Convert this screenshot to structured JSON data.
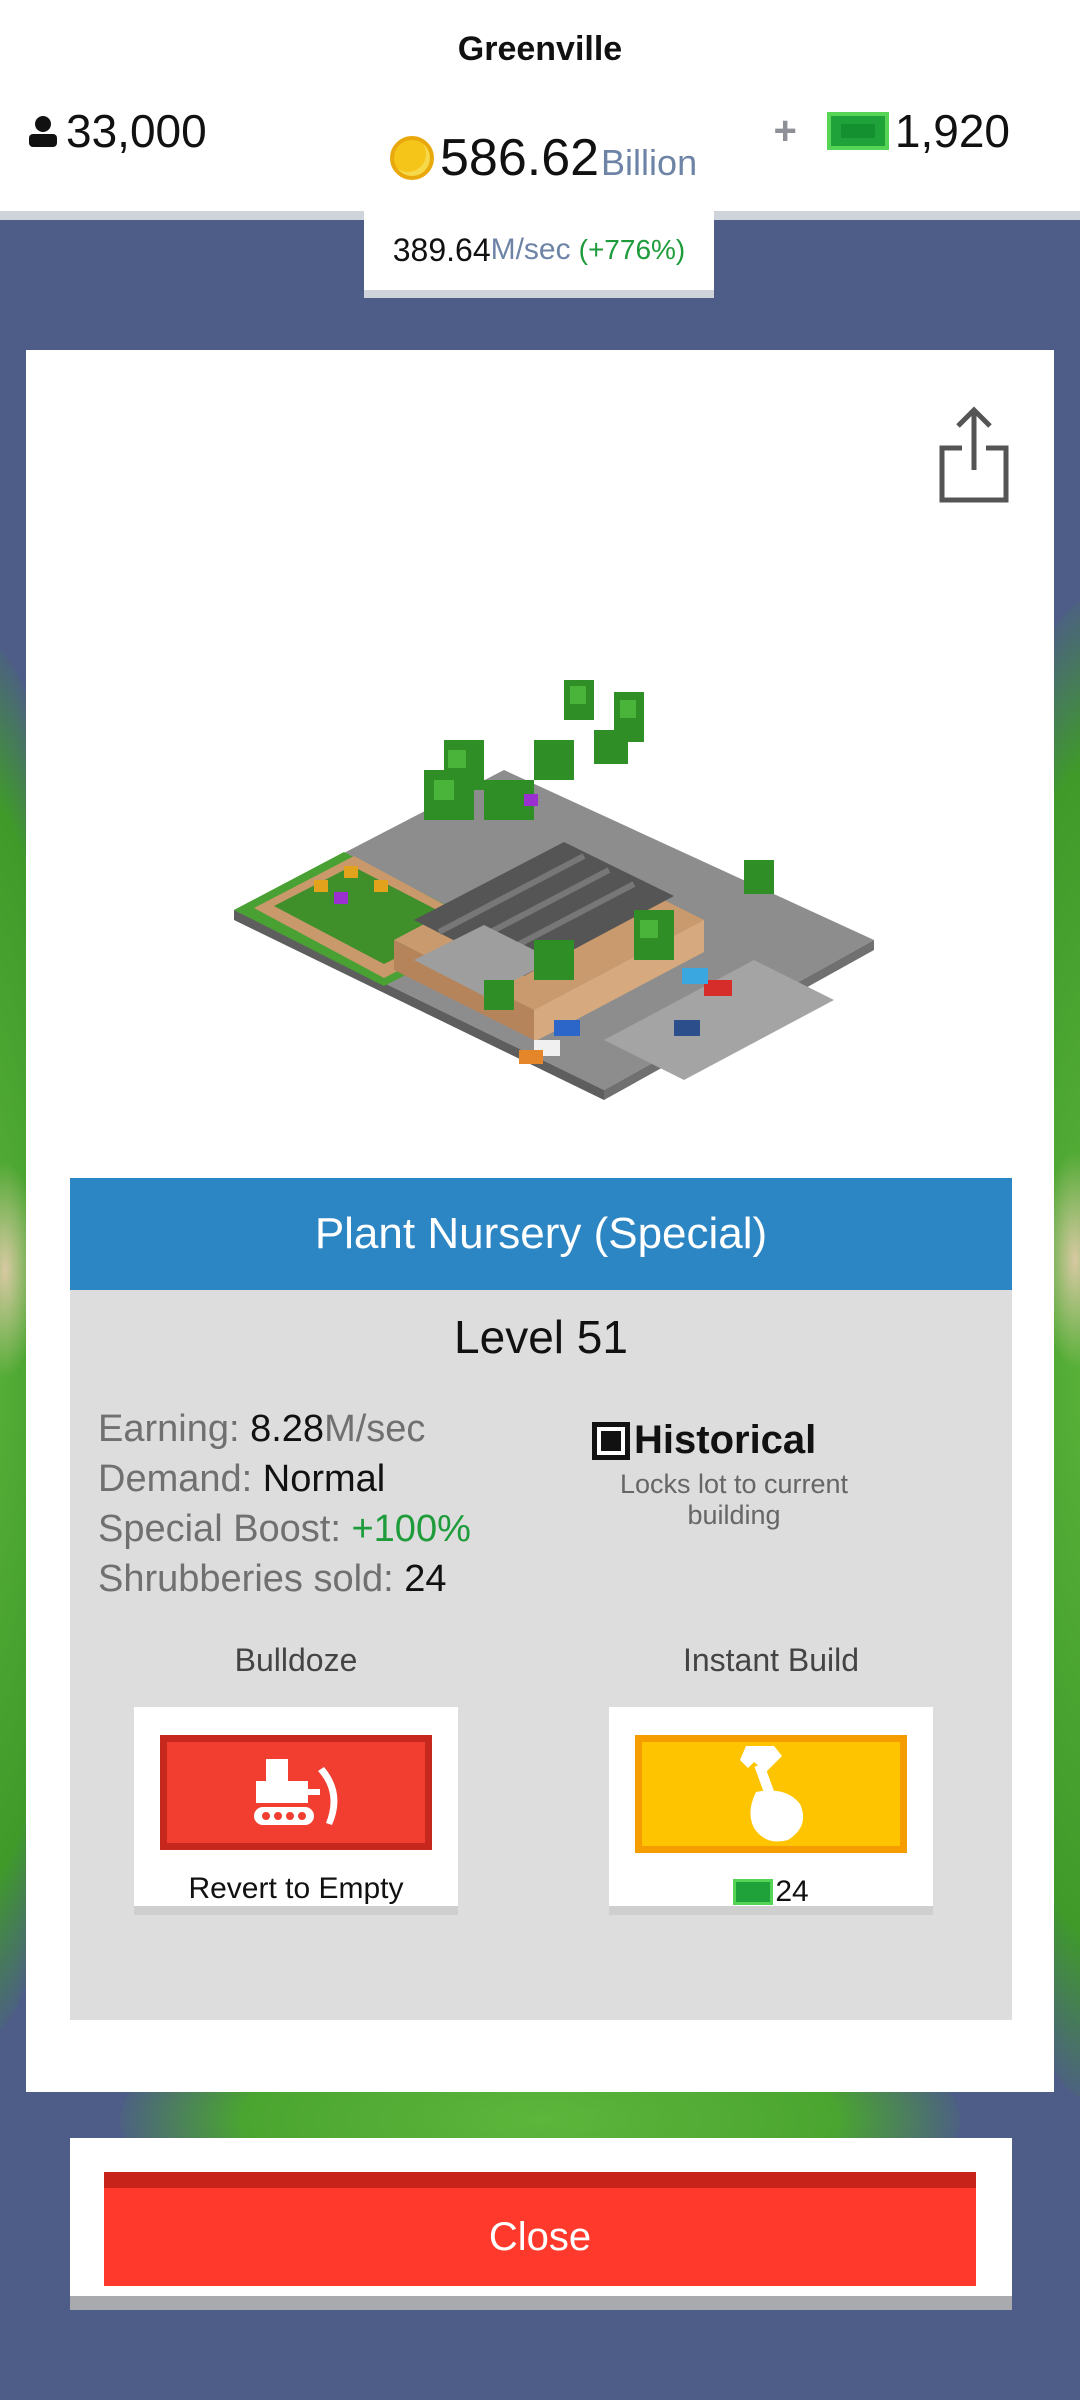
{
  "header": {
    "city_name": "Greenville",
    "population": "33,000",
    "money_amount": "586.62",
    "money_unit": "Billion",
    "cash_plus": "+",
    "cash_amount": "1,920",
    "income_rate": "389.64",
    "income_unit": "M/sec",
    "income_boost": "(+776%)"
  },
  "building": {
    "name": "Plant Nursery (Special)",
    "level": "Level 51",
    "earning_label": "Earning: ",
    "earning_value": "8.28",
    "earning_unit": "M/sec",
    "demand_label": "Demand: ",
    "demand_value": "Normal",
    "boost_label": "Special Boost: ",
    "boost_value": "+100%",
    "sold_label": "Shrubberies sold: ",
    "sold_value": "24"
  },
  "historical": {
    "label": "Historical",
    "description": "Locks lot to current building",
    "checked": true
  },
  "actions": {
    "bulldoze_title": "Bulldoze",
    "bulldoze_caption": "Revert to Empty",
    "instant_title": "Instant Build",
    "instant_cost": "24"
  },
  "close_label": "Close",
  "colors": {
    "background": "#4d5d87",
    "header_blue": "#2d86c4",
    "red_button": "#f23d31",
    "yellow_button": "#ffc400",
    "green_text": "#1e9b3a"
  },
  "icons": [
    "person-icon",
    "coin-icon",
    "cash-icon",
    "share-icon",
    "bulldozer-icon",
    "hammer-hand-icon"
  ]
}
